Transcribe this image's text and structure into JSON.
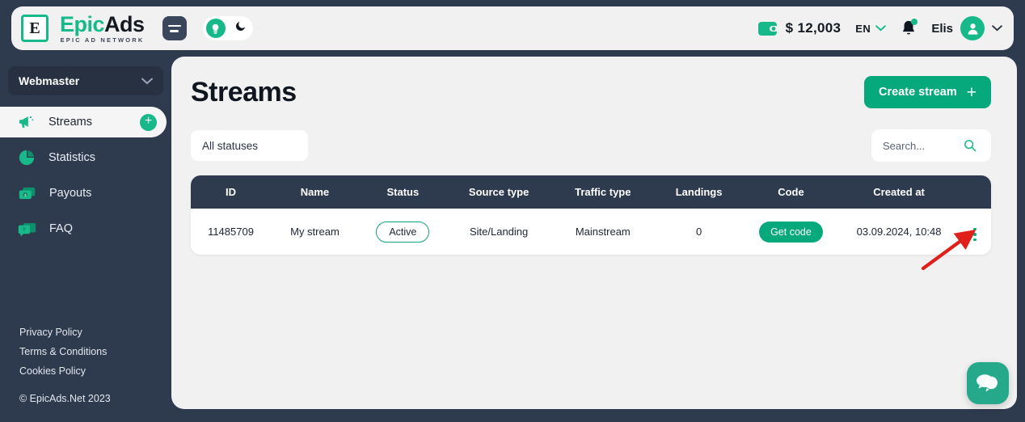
{
  "header": {
    "logo_initial": "E",
    "logo_epic": "Epic",
    "logo_ads": "Ads",
    "logo_tagline": "EPIC AD NETWORK",
    "menu_icon": "hamburger-menu-icon",
    "theme_light_icon": "lightbulb-icon",
    "theme_dark_icon": "moon-icon",
    "wallet_icon": "wallet-icon",
    "balance": "$ 12,003",
    "language": "EN",
    "language_caret": "chevron-down-icon",
    "bell_icon": "notification-bell-icon",
    "user_name": "Elis",
    "avatar_icon": "user-avatar-icon",
    "user_caret": "chevron-down-icon"
  },
  "sidebar": {
    "role": "Webmaster",
    "role_caret": "chevron-down-icon",
    "items": [
      {
        "label": "Streams",
        "icon": "megaphone-icon",
        "active": true,
        "badge": "+"
      },
      {
        "label": "Statistics",
        "icon": "pie-chart-icon",
        "active": false,
        "badge": ""
      },
      {
        "label": "Payouts",
        "icon": "money-icon",
        "active": false,
        "badge": ""
      },
      {
        "label": "FAQ",
        "icon": "question-chat-icon",
        "active": false,
        "badge": ""
      }
    ],
    "footer_links": [
      "Privacy Policy",
      "Terms & Conditions",
      "Cookies Policy"
    ],
    "copyright": "© EpicAds.Net 2023"
  },
  "main": {
    "title": "Streams",
    "create_button": "Create stream",
    "create_button_icon": "plus-icon",
    "status_filter": "All statuses",
    "search_placeholder": "Search...",
    "search_value": "",
    "search_icon": "search-icon",
    "table": {
      "columns": [
        "ID",
        "Name",
        "Status",
        "Source type",
        "Traffic type",
        "Landings",
        "Code",
        "Created at"
      ],
      "rows": [
        {
          "id": "11485709",
          "name": "My stream",
          "status": "Active",
          "source_type": "Site/Landing",
          "traffic_type": "Mainstream",
          "landings": "0",
          "code": "Get code",
          "created_at": "03.09.2024, 10:48",
          "actions_icon": "kebab-menu-icon"
        }
      ]
    }
  },
  "chat": {
    "icon": "chat-bubble-icon"
  },
  "annotation": {
    "arrow_icon": "red-arrow-icon",
    "color": "#e0201b"
  },
  "colors": {
    "accent_green": "#17b98a",
    "button_green": "#06a97c",
    "dark_navy": "#2e3a4d",
    "panel_light": "#f1f1f1",
    "white": "#ffffff"
  }
}
